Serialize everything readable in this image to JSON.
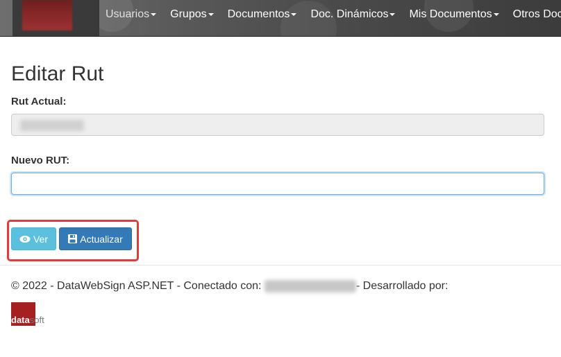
{
  "nav": {
    "items": [
      {
        "label": "Usuarios"
      },
      {
        "label": "Grupos"
      },
      {
        "label": "Documentos"
      },
      {
        "label": "Doc. Dinámicos"
      },
      {
        "label": "Mis Documentos"
      },
      {
        "label": "Otros Doc"
      }
    ]
  },
  "page": {
    "title": "Editar Rut"
  },
  "form": {
    "rut_actual_label": "Rut Actual:",
    "nuevo_rut_label": "Nuevo RUT:",
    "nuevo_rut_value": ""
  },
  "buttons": {
    "ver_label": "Ver",
    "actualizar_label": "Actualizar"
  },
  "footer": {
    "text_before": "© 2022 - DataWebSign ASP.NET - Conectado con:",
    "text_after": "- Desarrollado por:"
  },
  "logo": {
    "part1": "data",
    "part2": "soft"
  },
  "colors": {
    "info": "#5bc0de",
    "primary": "#337ab7",
    "highlight": "#e23b3b",
    "logo_red": "#a52020"
  }
}
